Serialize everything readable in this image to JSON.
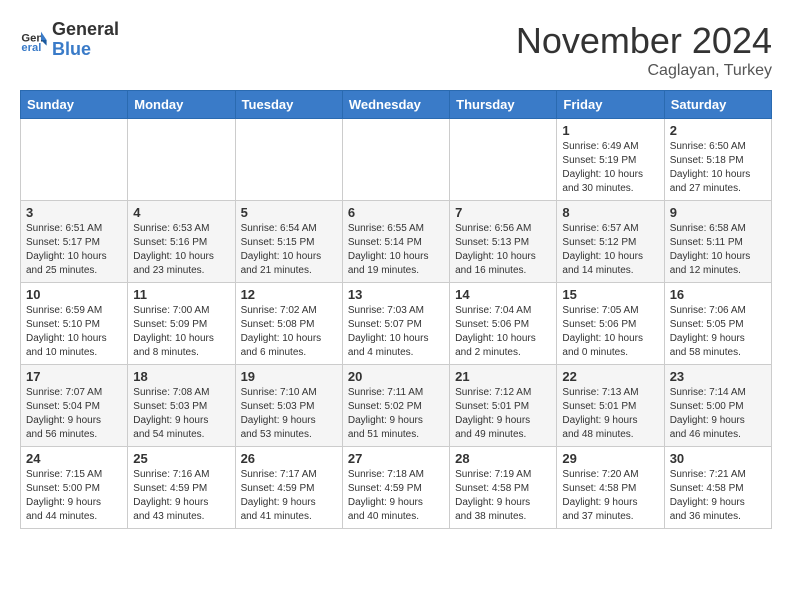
{
  "header": {
    "logo_general": "General",
    "logo_blue": "Blue",
    "month_title": "November 2024",
    "location": "Caglayan, Turkey"
  },
  "weekdays": [
    "Sunday",
    "Monday",
    "Tuesday",
    "Wednesday",
    "Thursday",
    "Friday",
    "Saturday"
  ],
  "weeks": [
    [
      {
        "day": "",
        "info": ""
      },
      {
        "day": "",
        "info": ""
      },
      {
        "day": "",
        "info": ""
      },
      {
        "day": "",
        "info": ""
      },
      {
        "day": "",
        "info": ""
      },
      {
        "day": "1",
        "info": "Sunrise: 6:49 AM\nSunset: 5:19 PM\nDaylight: 10 hours\nand 30 minutes."
      },
      {
        "day": "2",
        "info": "Sunrise: 6:50 AM\nSunset: 5:18 PM\nDaylight: 10 hours\nand 27 minutes."
      }
    ],
    [
      {
        "day": "3",
        "info": "Sunrise: 6:51 AM\nSunset: 5:17 PM\nDaylight: 10 hours\nand 25 minutes."
      },
      {
        "day": "4",
        "info": "Sunrise: 6:53 AM\nSunset: 5:16 PM\nDaylight: 10 hours\nand 23 minutes."
      },
      {
        "day": "5",
        "info": "Sunrise: 6:54 AM\nSunset: 5:15 PM\nDaylight: 10 hours\nand 21 minutes."
      },
      {
        "day": "6",
        "info": "Sunrise: 6:55 AM\nSunset: 5:14 PM\nDaylight: 10 hours\nand 19 minutes."
      },
      {
        "day": "7",
        "info": "Sunrise: 6:56 AM\nSunset: 5:13 PM\nDaylight: 10 hours\nand 16 minutes."
      },
      {
        "day": "8",
        "info": "Sunrise: 6:57 AM\nSunset: 5:12 PM\nDaylight: 10 hours\nand 14 minutes."
      },
      {
        "day": "9",
        "info": "Sunrise: 6:58 AM\nSunset: 5:11 PM\nDaylight: 10 hours\nand 12 minutes."
      }
    ],
    [
      {
        "day": "10",
        "info": "Sunrise: 6:59 AM\nSunset: 5:10 PM\nDaylight: 10 hours\nand 10 minutes."
      },
      {
        "day": "11",
        "info": "Sunrise: 7:00 AM\nSunset: 5:09 PM\nDaylight: 10 hours\nand 8 minutes."
      },
      {
        "day": "12",
        "info": "Sunrise: 7:02 AM\nSunset: 5:08 PM\nDaylight: 10 hours\nand 6 minutes."
      },
      {
        "day": "13",
        "info": "Sunrise: 7:03 AM\nSunset: 5:07 PM\nDaylight: 10 hours\nand 4 minutes."
      },
      {
        "day": "14",
        "info": "Sunrise: 7:04 AM\nSunset: 5:06 PM\nDaylight: 10 hours\nand 2 minutes."
      },
      {
        "day": "15",
        "info": "Sunrise: 7:05 AM\nSunset: 5:06 PM\nDaylight: 10 hours\nand 0 minutes."
      },
      {
        "day": "16",
        "info": "Sunrise: 7:06 AM\nSunset: 5:05 PM\nDaylight: 9 hours\nand 58 minutes."
      }
    ],
    [
      {
        "day": "17",
        "info": "Sunrise: 7:07 AM\nSunset: 5:04 PM\nDaylight: 9 hours\nand 56 minutes."
      },
      {
        "day": "18",
        "info": "Sunrise: 7:08 AM\nSunset: 5:03 PM\nDaylight: 9 hours\nand 54 minutes."
      },
      {
        "day": "19",
        "info": "Sunrise: 7:10 AM\nSunset: 5:03 PM\nDaylight: 9 hours\nand 53 minutes."
      },
      {
        "day": "20",
        "info": "Sunrise: 7:11 AM\nSunset: 5:02 PM\nDaylight: 9 hours\nand 51 minutes."
      },
      {
        "day": "21",
        "info": "Sunrise: 7:12 AM\nSunset: 5:01 PM\nDaylight: 9 hours\nand 49 minutes."
      },
      {
        "day": "22",
        "info": "Sunrise: 7:13 AM\nSunset: 5:01 PM\nDaylight: 9 hours\nand 48 minutes."
      },
      {
        "day": "23",
        "info": "Sunrise: 7:14 AM\nSunset: 5:00 PM\nDaylight: 9 hours\nand 46 minutes."
      }
    ],
    [
      {
        "day": "24",
        "info": "Sunrise: 7:15 AM\nSunset: 5:00 PM\nDaylight: 9 hours\nand 44 minutes."
      },
      {
        "day": "25",
        "info": "Sunrise: 7:16 AM\nSunset: 4:59 PM\nDaylight: 9 hours\nand 43 minutes."
      },
      {
        "day": "26",
        "info": "Sunrise: 7:17 AM\nSunset: 4:59 PM\nDaylight: 9 hours\nand 41 minutes."
      },
      {
        "day": "27",
        "info": "Sunrise: 7:18 AM\nSunset: 4:59 PM\nDaylight: 9 hours\nand 40 minutes."
      },
      {
        "day": "28",
        "info": "Sunrise: 7:19 AM\nSunset: 4:58 PM\nDaylight: 9 hours\nand 38 minutes."
      },
      {
        "day": "29",
        "info": "Sunrise: 7:20 AM\nSunset: 4:58 PM\nDaylight: 9 hours\nand 37 minutes."
      },
      {
        "day": "30",
        "info": "Sunrise: 7:21 AM\nSunset: 4:58 PM\nDaylight: 9 hours\nand 36 minutes."
      }
    ]
  ]
}
